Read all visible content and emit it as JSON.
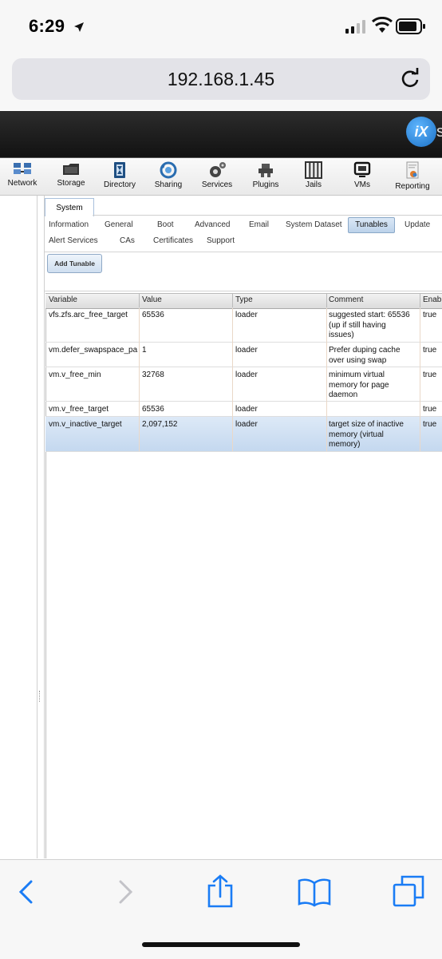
{
  "status_bar": {
    "time": "6:29"
  },
  "browser": {
    "url": "192.168.1.45"
  },
  "app": {
    "logo_text": "iX",
    "logo_suffix": "s"
  },
  "toolbar": {
    "items": [
      {
        "label": "Network",
        "icon": "network-icon"
      },
      {
        "label": "Storage",
        "icon": "storage-icon"
      },
      {
        "label": "Directory",
        "icon": "directory-icon"
      },
      {
        "label": "Sharing",
        "icon": "sharing-icon"
      },
      {
        "label": "Services",
        "icon": "services-icon"
      },
      {
        "label": "Plugins",
        "icon": "plugins-icon"
      },
      {
        "label": "Jails",
        "icon": "jails-icon"
      },
      {
        "label": "VMs",
        "icon": "vms-icon"
      },
      {
        "label": "Reporting",
        "icon": "reporting-icon"
      }
    ]
  },
  "system_tab": {
    "label": "System"
  },
  "subtabs": {
    "row1": [
      "Information",
      "General",
      "Boot",
      "Advanced",
      "Email",
      "System Dataset",
      "Tunables",
      "Update"
    ],
    "row2": [
      "Alert Services",
      "CAs",
      "Certificates",
      "Support"
    ],
    "active": "Tunables"
  },
  "actions": {
    "add_tunable": "Add Tunable"
  },
  "grid": {
    "columns": [
      "Variable",
      "Value",
      "Type",
      "Comment",
      "Enabled"
    ],
    "column_header_visible": [
      "Variable",
      "Value",
      "Type",
      "Comment",
      "Enabl"
    ],
    "rows": [
      {
        "variable": "vfs.zfs.arc_free_target",
        "value": "65536",
        "type": "loader",
        "comment": "suggested start: 65536\n(up if still having\nissues)",
        "enabled": "true"
      },
      {
        "variable": "vm.defer_swapspace_pa",
        "value": "1",
        "type": "loader",
        "comment": "Prefer duping cache\nover using swap",
        "enabled": "true"
      },
      {
        "variable": "vm.v_free_min",
        "value": "32768",
        "type": "loader",
        "comment": "minimum virtual\nmemory for page\ndaemon",
        "enabled": "true"
      },
      {
        "variable": "vm.v_free_target",
        "value": "65536",
        "type": "loader",
        "comment": "",
        "enabled": "true"
      },
      {
        "variable": "vm.v_inactive_target",
        "value": "2,097,152",
        "type": "loader",
        "comment": "target size of inactive\nmemory (virtual\nmemory)",
        "enabled": "true",
        "selected": true
      }
    ]
  },
  "bottom_nav": {
    "items": [
      "back-icon",
      "forward-icon",
      "share-icon",
      "bookmarks-icon",
      "tabs-icon"
    ]
  }
}
